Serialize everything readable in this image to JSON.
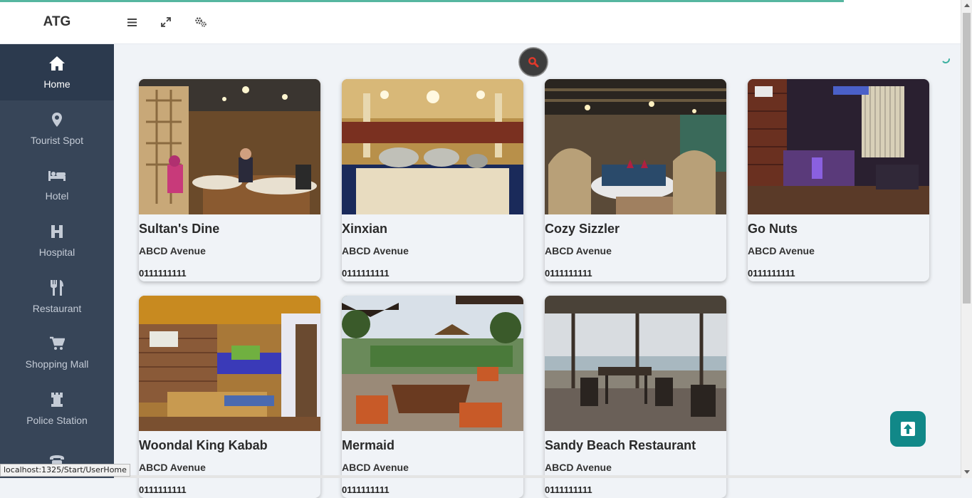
{
  "app": {
    "brand": "ATG"
  },
  "toolbar": {
    "menu_icon": "hamburger-icon",
    "expand_icon": "expand-icon",
    "settings_icon": "cogs-icon"
  },
  "sidebar": {
    "items": [
      {
        "label": "Home",
        "icon": "home-icon",
        "active": true
      },
      {
        "label": "Tourist Spot",
        "icon": "map-marker-icon"
      },
      {
        "label": "Hotel",
        "icon": "bed-icon"
      },
      {
        "label": "Hospital",
        "icon": "hospital-h-icon"
      },
      {
        "label": "Restaurant",
        "icon": "cutlery-icon"
      },
      {
        "label": "Shopping Mall",
        "icon": "shopping-cart-icon"
      },
      {
        "label": "Police Station",
        "icon": "tower-icon"
      },
      {
        "label": "",
        "icon": "phone-icon"
      }
    ]
  },
  "status_url": "localhost:1325/Start/UserHome",
  "restaurants": [
    {
      "name": "Sultan's Dine",
      "address": "ABCD Avenue",
      "phone": "0111111111"
    },
    {
      "name": "Xinxian",
      "address": "ABCD Avenue",
      "phone": "0111111111"
    },
    {
      "name": "Cozy Sizzler",
      "address": "ABCD Avenue",
      "phone": "0111111111"
    },
    {
      "name": "Go Nuts",
      "address": "ABCD Avenue",
      "phone": "0111111111"
    },
    {
      "name": "Woondal King Kabab",
      "address": "ABCD Avenue",
      "phone": "0111111111"
    },
    {
      "name": "Mermaid",
      "address": "ABCD Avenue",
      "phone": "0111111111"
    },
    {
      "name": "Sandy Beach Restaurant",
      "address": "ABCD Avenue",
      "phone": "0111111111"
    }
  ],
  "colors": {
    "sidebar": "#374558",
    "sidebar_active": "#2c3a4e",
    "accent": "#118888",
    "progress": "#56b6a0",
    "search_icon": "#e0392b"
  }
}
